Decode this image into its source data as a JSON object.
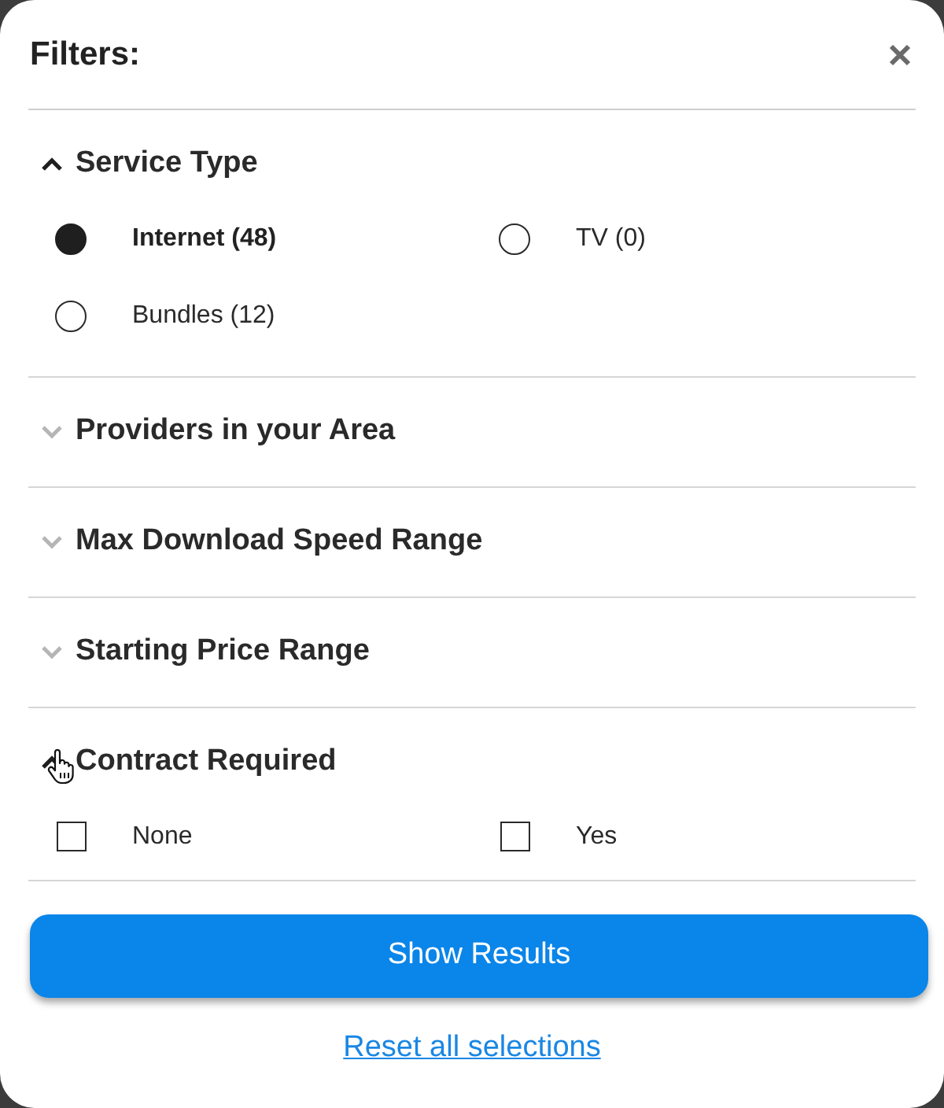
{
  "title": "Filters:",
  "sections": [
    {
      "title": "Service Type",
      "expanded": true,
      "kind": "radio",
      "options": [
        {
          "label": "Internet (48)",
          "selected": true
        },
        {
          "label": "TV (0)",
          "selected": false
        },
        {
          "label": "Bundles (12)",
          "selected": false
        }
      ]
    },
    {
      "title": "Providers in your Area",
      "expanded": false
    },
    {
      "title": "Max Download Speed Range",
      "expanded": false
    },
    {
      "title": "Starting Price Range",
      "expanded": false
    },
    {
      "title": "Contract Required",
      "expanded": true,
      "kind": "checkbox",
      "options": [
        {
          "label": "None",
          "checked": false
        },
        {
          "label": "Yes",
          "checked": false
        }
      ]
    }
  ],
  "primary_button": "Show Results",
  "reset_link": "Reset all selections"
}
